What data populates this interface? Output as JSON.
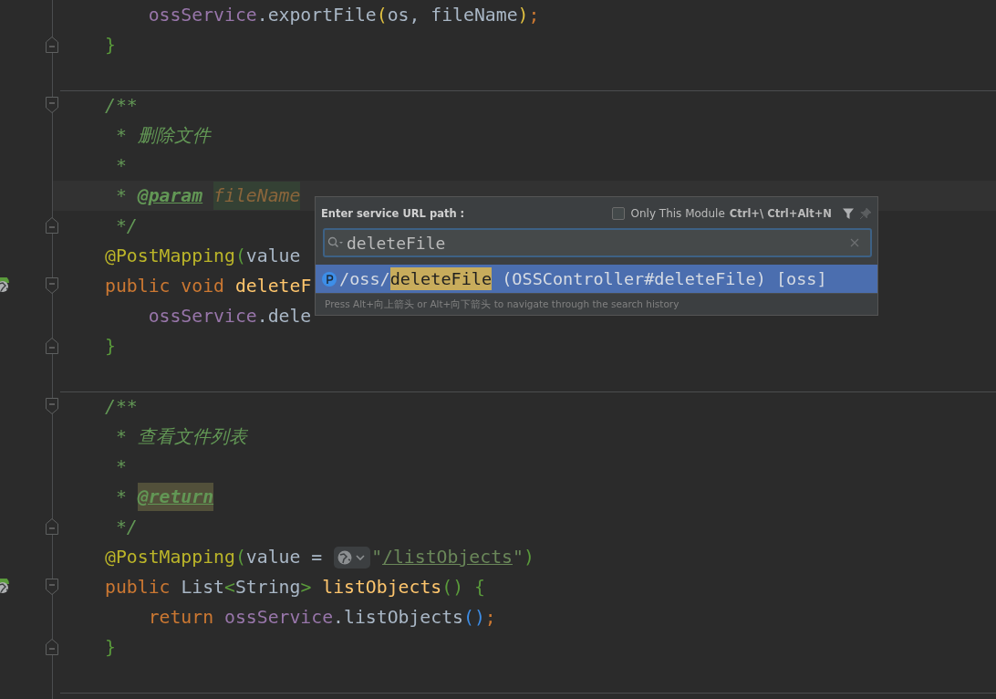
{
  "editor": {
    "lines": [
      {
        "kind": "code",
        "indent": true,
        "tokens": [
          {
            "text": "ossService",
            "kind": "field"
          },
          {
            "text": ".exportFile",
            "kind": "plain"
          },
          {
            "text": "(",
            "kind": "bracket_yellow"
          },
          {
            "text": "os, fileName",
            "kind": "plain"
          },
          {
            "text": ")",
            "kind": "bracket_yellow"
          },
          {
            "text": ";",
            "kind": "keyword"
          }
        ]
      },
      {
        "kind": "code",
        "fold_end": true,
        "tokens": [
          {
            "text": "}",
            "kind": "bracket_green"
          }
        ]
      },
      {
        "kind": "blank"
      },
      {
        "kind": "code",
        "separator": true,
        "fold_start": true,
        "tokens": [
          {
            "text": "/**",
            "kind": "comment"
          }
        ]
      },
      {
        "kind": "code",
        "tokens": [
          {
            "text": " * 删除文件",
            "kind": "comment"
          }
        ]
      },
      {
        "kind": "code",
        "tokens": [
          {
            "text": " *",
            "kind": "comment"
          }
        ]
      },
      {
        "kind": "code",
        "current": true,
        "tokens": [
          {
            "text": " * ",
            "kind": "comment"
          },
          {
            "text": "@param",
            "kind": "doc_tag"
          },
          {
            "text": "fileName",
            "kind": "param"
          }
        ]
      },
      {
        "kind": "code",
        "fold_end": true,
        "tokens": [
          {
            "text": " */",
            "kind": "comment"
          }
        ]
      },
      {
        "kind": "code",
        "tokens": [
          {
            "text": "@PostMapping",
            "kind": "annotation"
          },
          {
            "text": "(",
            "kind": "bracket_green"
          },
          {
            "text": "value",
            "kind": "plain"
          }
        ]
      },
      {
        "kind": "code",
        "endpoint": true,
        "fold_start": true,
        "tokens": [
          {
            "text": "public void ",
            "kind": "keyword"
          },
          {
            "text": "deleteF",
            "kind": "method"
          }
        ]
      },
      {
        "kind": "code",
        "indent": true,
        "tokens": [
          {
            "text": "ossService",
            "kind": "field"
          },
          {
            "text": ".dele",
            "kind": "plain"
          }
        ]
      },
      {
        "kind": "code",
        "fold_end": true,
        "tokens": [
          {
            "text": "}",
            "kind": "bracket_green"
          }
        ]
      },
      {
        "kind": "blank"
      },
      {
        "kind": "code",
        "separator": true,
        "fold_start": true,
        "tokens": [
          {
            "text": "/**",
            "kind": "comment"
          }
        ]
      },
      {
        "kind": "code",
        "tokens": [
          {
            "text": " * 查看文件列表",
            "kind": "comment"
          }
        ]
      },
      {
        "kind": "code",
        "tokens": [
          {
            "text": " *",
            "kind": "comment"
          }
        ]
      },
      {
        "kind": "code",
        "tokens": [
          {
            "text": " * ",
            "kind": "comment"
          },
          {
            "text": "@return",
            "kind": "doc_tag_marked"
          }
        ]
      },
      {
        "kind": "code",
        "fold_end": true,
        "tokens": [
          {
            "text": " */",
            "kind": "comment"
          }
        ]
      },
      {
        "kind": "code",
        "tokens": [
          {
            "text": "@PostMapping",
            "kind": "annotation"
          },
          {
            "text": "(",
            "kind": "bracket_green"
          },
          {
            "text": "value = ",
            "kind": "plain"
          },
          {
            "kind": "globe_inlay"
          },
          {
            "text": "\"",
            "kind": "string"
          },
          {
            "text": "/listObjects",
            "kind": "url"
          },
          {
            "text": "\"",
            "kind": "string"
          },
          {
            "text": ")",
            "kind": "bracket_green"
          }
        ]
      },
      {
        "kind": "code",
        "endpoint": true,
        "fold_start": true,
        "tokens": [
          {
            "text": "public ",
            "kind": "keyword"
          },
          {
            "text": "List",
            "kind": "plain"
          },
          {
            "text": "<",
            "kind": "bracket_green"
          },
          {
            "text": "String",
            "kind": "plain"
          },
          {
            "text": "> ",
            "kind": "bracket_green"
          },
          {
            "text": "listObjects",
            "kind": "method"
          },
          {
            "text": "() {",
            "kind": "bracket_green"
          }
        ]
      },
      {
        "kind": "code",
        "indent": true,
        "tokens": [
          {
            "text": "return ",
            "kind": "keyword"
          },
          {
            "text": "ossService",
            "kind": "field"
          },
          {
            "text": ".listObjects",
            "kind": "plain"
          },
          {
            "text": "()",
            "kind": "bracket_blue"
          },
          {
            "text": ";",
            "kind": "keyword"
          }
        ]
      },
      {
        "kind": "code",
        "fold_end": true,
        "tokens": [
          {
            "text": "}",
            "kind": "bracket_green"
          }
        ]
      },
      {
        "kind": "blank"
      },
      {
        "kind": "blank",
        "separator": true
      }
    ]
  },
  "popup": {
    "title": "Enter service URL path :",
    "module_option": {
      "label": "Only This Module",
      "shortcut": "Ctrl+\\ Ctrl+Alt+N",
      "checked": false
    },
    "search": {
      "value": "deleteFile"
    },
    "results": [
      {
        "prefix": "/oss/",
        "match": "deleteFile",
        "suffix": " (OSSController#deleteFile) [oss]",
        "selected": true
      }
    ],
    "hint": "Press Alt+向上箭头 or Alt+向下箭头 to navigate through the search history"
  }
}
